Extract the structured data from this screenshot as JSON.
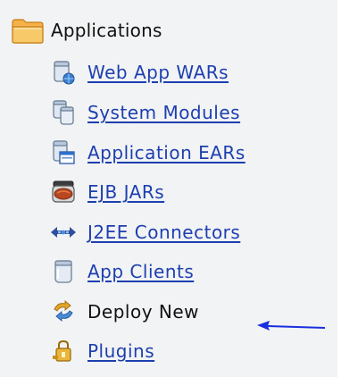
{
  "tree": {
    "root": {
      "label": "Applications",
      "icon": "folder-icon"
    },
    "items": [
      {
        "label": "Web App WARs",
        "icon": "web-app-icon",
        "link": true
      },
      {
        "label": "System Modules",
        "icon": "system-modules-icon",
        "link": true
      },
      {
        "label": "Application EARs",
        "icon": "application-ear-icon",
        "link": true
      },
      {
        "label": "EJB JARs",
        "icon": "ejb-jar-icon",
        "link": true
      },
      {
        "label": "J2EE Connectors",
        "icon": "connector-icon",
        "link": true
      },
      {
        "label": "App Clients",
        "icon": "app-client-icon",
        "link": true
      },
      {
        "label": "Deploy New",
        "icon": "deploy-icon",
        "link": false
      },
      {
        "label": "Plugins",
        "icon": "plugin-icon",
        "link": true
      }
    ]
  },
  "colors": {
    "panel_bg": "#f2f3f4",
    "link": "#1d3fb0",
    "arrow": "#1a2ee0",
    "folder": "#f2b24a"
  },
  "annotation": {
    "icon": "arrow-left-icon"
  }
}
